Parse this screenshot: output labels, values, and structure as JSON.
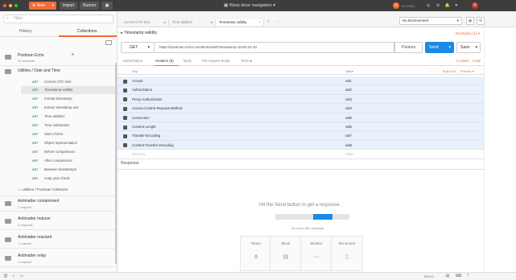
{
  "topbar": {
    "new_label": "New",
    "import_label": "Import",
    "runner_label": "Runner",
    "title": "Warp drive navigation",
    "sync_label": "IN SYNC",
    "avatar_letter": "R"
  },
  "sidebar": {
    "filter_placeholder": "Filter",
    "tabs": [
      "History",
      "Collections"
    ],
    "collections": [
      {
        "name": "Postman Echo",
        "sub": "14 requests"
      },
      {
        "name": "Utilities / Date and Time",
        "sub": ""
      }
    ],
    "requests": [
      {
        "method": "GET",
        "name": "Current UTC time"
      },
      {
        "method": "GET",
        "name": "Timestamp validity"
      },
      {
        "method": "GET",
        "name": "Format timestamp"
      },
      {
        "method": "GET",
        "name": "Extract timestamp unit"
      },
      {
        "method": "GET",
        "name": "Time addition"
      },
      {
        "method": "GET",
        "name": "Time subtraction"
      },
      {
        "method": "GET",
        "name": "Start of time"
      },
      {
        "method": "GET",
        "name": "Object representation"
      },
      {
        "method": "GET",
        "name": "Before comparisons"
      },
      {
        "method": "GET",
        "name": "After comparisons"
      },
      {
        "method": "GET",
        "name": "Between timestamps"
      },
      {
        "method": "GET",
        "name": "Leap year check"
      }
    ],
    "folder_row": "Utilities / Postman Collection",
    "more_collections": [
      {
        "name": "Antimatter containment",
        "sub": "1 request"
      },
      {
        "name": "Antimatter Inducer",
        "sub": "2 requests"
      },
      {
        "name": "Antimatter reactant",
        "sub": "1 request"
      },
      {
        "name": "Antimatter relay",
        "sub": "1 request"
      }
    ]
  },
  "tabs": [
    {
      "label": "Current UTC time"
    },
    {
      "label": "Time addition"
    },
    {
      "label": "Timestamp validity"
    }
  ],
  "environment": {
    "selected": "No Environment"
  },
  "request": {
    "title": "Timestamp validity",
    "examples_label": "Examples (1)",
    "method": "GET",
    "url": "https://postman-echo.com/time/valid?timestamp=2016-10-10",
    "params_label": "Params",
    "send_label": "Send",
    "save_label": "Save"
  },
  "subtabs": {
    "items": [
      "Authorization",
      "Headers (8)",
      "Body",
      "Pre-request Script",
      "Tests"
    ],
    "cookies": "Cookies",
    "code": "Code"
  },
  "headers_table": {
    "key_header": "Key",
    "value_header": "Value",
    "bulk_edit": "Bulk Edit",
    "presets": "Presets",
    "rows": [
      {
        "key": "Accept",
        "value": "val1"
      },
      {
        "key": "Authorization",
        "value": "val2"
      },
      {
        "key": "Proxy-Authorization",
        "value": "val3"
      },
      {
        "key": "Access-Control-Request-Method",
        "value": "val4"
      },
      {
        "key": "Connection",
        "value": "val5"
      },
      {
        "key": "Content-Length",
        "value": "val6"
      },
      {
        "key": "Transfer-Encoding",
        "value": "val7"
      },
      {
        "key": "Content-Transfer-Encoding",
        "value": "val8"
      }
    ],
    "new_key_placeholder": "New key",
    "new_value_placeholder": "Value"
  },
  "response": {
    "label": "Response",
    "hint": "Hit the Send button to get a response.",
    "more_actions": "Do more with requests",
    "actions": [
      "Share",
      "Mock",
      "Monitor",
      "Document"
    ]
  },
  "statusbar": {
    "version_label": "BUILD"
  },
  "colors": {
    "accent": "#f26b3a",
    "send": "#1a8ae6",
    "method_get": "#2d9c4a",
    "selected_row": "#e8f0fb"
  }
}
